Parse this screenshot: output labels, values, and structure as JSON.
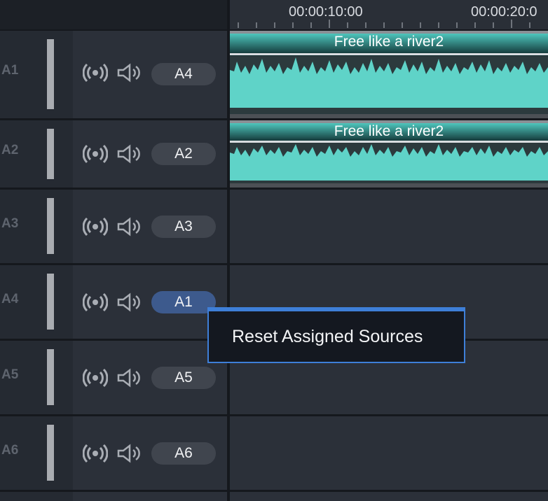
{
  "ruler": {
    "timecodes": [
      "00:00:10:00",
      "00:00:20:0"
    ]
  },
  "tracks": [
    {
      "name": "A1",
      "source": "A4",
      "source_active": false
    },
    {
      "name": "A2",
      "source": "A2",
      "source_active": false
    },
    {
      "name": "A3",
      "source": "A3",
      "source_active": false
    },
    {
      "name": "A4",
      "source": "A1",
      "source_active": true
    },
    {
      "name": "A5",
      "source": "A5",
      "source_active": false
    },
    {
      "name": "A6",
      "source": "A6",
      "source_active": false
    }
  ],
  "clips": [
    {
      "title": "Free like a river2",
      "track": "A1"
    },
    {
      "title": "Free like a river2",
      "track": "A2"
    }
  ],
  "context_menu": {
    "items": [
      "Reset Assigned Sources"
    ],
    "border_color": "#3e7fd8"
  },
  "colors": {
    "waveform": "#5fd3c8",
    "source_active": "#3d5a8d",
    "source_default": "#40454e"
  },
  "icons": [
    "broadcast-icon",
    "speaker-icon"
  ]
}
